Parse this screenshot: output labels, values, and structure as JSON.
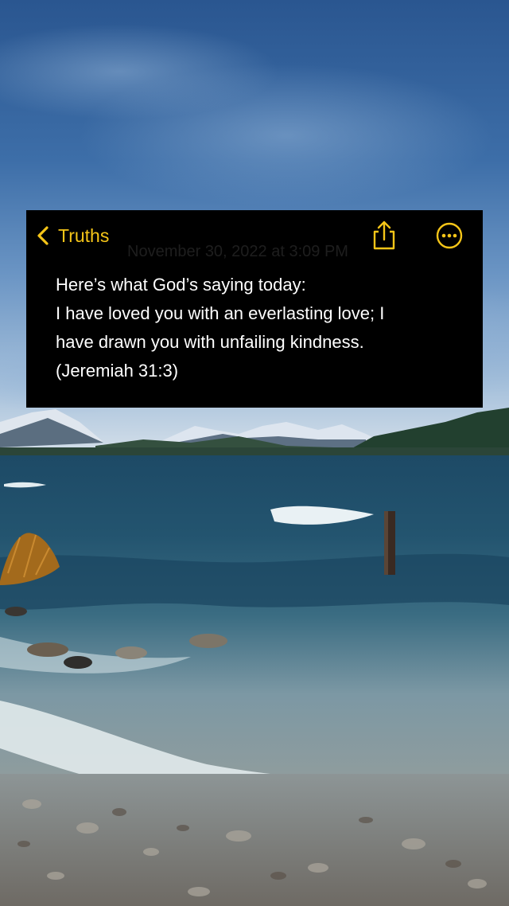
{
  "note": {
    "back_label": "Truths",
    "timestamp": "November 30, 2022 at 3:09 PM",
    "lines": [
      "Here’s what God’s saying today:",
      "I have loved you with an everlasting love; I",
      "have drawn you with unfailing kindness.",
      "(Jeremiah 31:3)"
    ]
  },
  "icons": {
    "back": "chevron-left-icon",
    "share": "share-icon",
    "more": "ellipsis-circle-icon"
  },
  "colors": {
    "accent": "#f5c518",
    "note_background": "#000000",
    "note_text": "#ffffff"
  }
}
